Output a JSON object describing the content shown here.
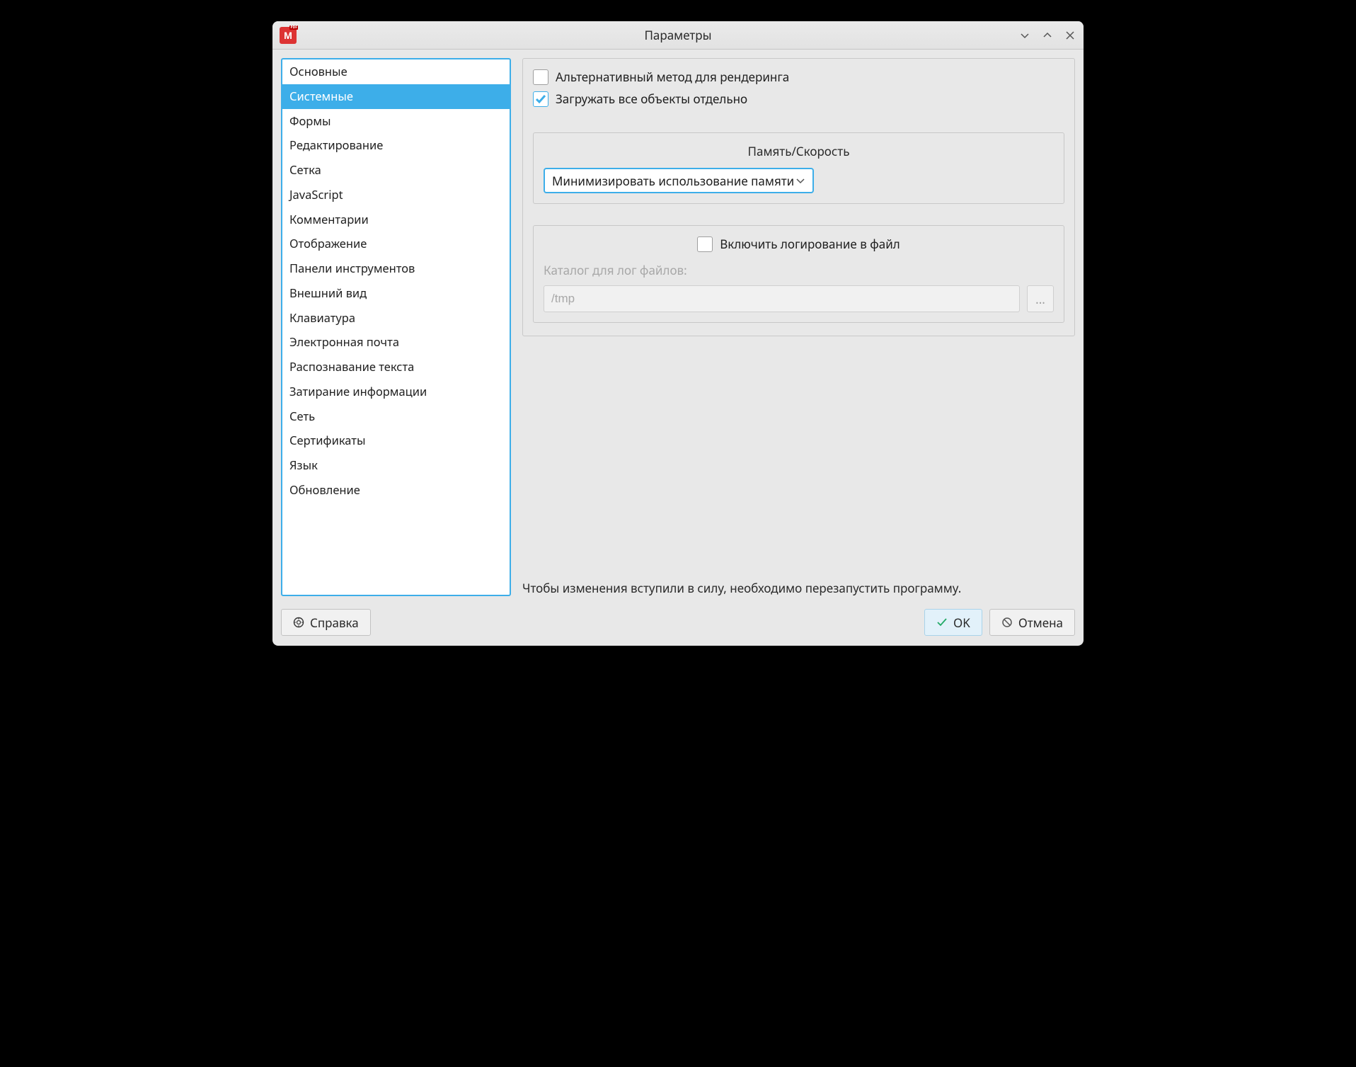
{
  "window": {
    "title": "Параметры"
  },
  "sidebar": {
    "items": [
      {
        "label": "Основные"
      },
      {
        "label": "Системные"
      },
      {
        "label": "Формы"
      },
      {
        "label": "Редактирование"
      },
      {
        "label": "Сетка"
      },
      {
        "label": "JavaScript"
      },
      {
        "label": "Комментарии"
      },
      {
        "label": "Отображение"
      },
      {
        "label": "Панели инструментов"
      },
      {
        "label": "Внешний вид"
      },
      {
        "label": "Клавиатура"
      },
      {
        "label": "Электронная почта"
      },
      {
        "label": "Распознавание текста"
      },
      {
        "label": "Затирание информации"
      },
      {
        "label": "Сеть"
      },
      {
        "label": "Сертификаты"
      },
      {
        "label": "Язык"
      },
      {
        "label": "Обновление"
      }
    ],
    "selected_index": 1
  },
  "settings": {
    "alt_render_label": "Альтернативный метод для рендеринга",
    "load_separately_label": "Загружать все объекты отдельно",
    "memory_group_title": "Память/Скорость",
    "memory_select_value": "Минимизировать использование памяти",
    "logging_checkbox_label": "Включить логирование в файл",
    "log_dir_label": "Каталог для лог файлов:",
    "log_dir_value": "/tmp",
    "browse_ellipsis": "...",
    "restart_note": "Чтобы изменения вступили в силу, необходимо перезапустить программу."
  },
  "footer": {
    "help_label": "Справка",
    "ok_label": "OK",
    "cancel_label": "Отмена"
  }
}
